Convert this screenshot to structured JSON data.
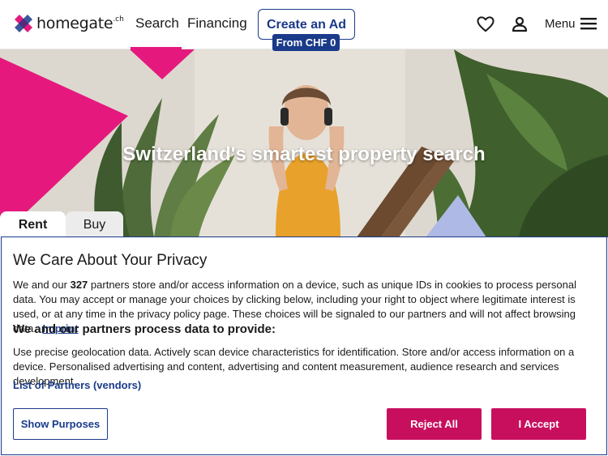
{
  "header": {
    "logo_text": "homegate",
    "logo_tld": ".ch",
    "nav": {
      "search": "Search",
      "financing": "Financing"
    },
    "create_ad": "Create an Ad",
    "create_ad_badge": "From CHF 0",
    "menu_label": "Menu"
  },
  "hero": {
    "title": "Switzerland's smartest property search",
    "tabs": {
      "rent": "Rent",
      "buy": "Buy"
    }
  },
  "privacy": {
    "title": "We Care About Your Privacy",
    "p1_before": "We and our",
    "partner_count": "327",
    "p1_after": "partners store and/or access information on a device, such as unique IDs in cookies to process personal data. You may accept or manage your choices by clicking below, including your right to object where legitimate interest is used, or at any time in the privacy policy page. These choices will be signaled to our partners and will not affect browsing data.",
    "imprint": "Imprint",
    "subtitle": "We and our partners process data to provide:",
    "p2": "Use precise geolocation data. Actively scan device characteristics for identification. Store and/or access information on a device. Personalised advertising and content, advertising and content measurement, audience research and services development.",
    "partners_link": "List of Partners (vendors)",
    "buttons": {
      "show_purposes": "Show Purposes",
      "reject_all": "Reject All",
      "accept": "I Accept"
    }
  },
  "colors": {
    "brand_pink": "#e5197d",
    "navy": "#1a3a8a",
    "button_pink": "#c80f5e"
  },
  "icons": [
    "homegate-logo-icon",
    "heart-icon",
    "user-icon",
    "menu-icon"
  ]
}
